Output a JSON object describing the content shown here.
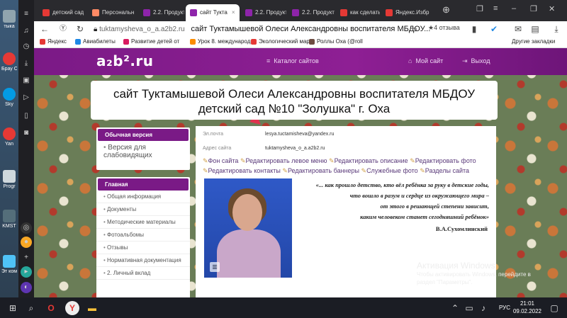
{
  "desktop": {
    "icons": [
      {
        "label": "тыка"
      },
      {
        "label": "Брау Ор"
      },
      {
        "label": "Sky"
      },
      {
        "label": "Yan"
      },
      {
        "label": "Progr"
      },
      {
        "label": "KMST"
      },
      {
        "label": "Эт компь"
      }
    ]
  },
  "browser": {
    "tabs": [
      {
        "label": "детский сад",
        "color": "#e53935"
      },
      {
        "label": "Персональн",
        "color": "#ff8a65"
      },
      {
        "label": "2.2. Продукт",
        "color": "#8e24aa"
      },
      {
        "label": "сайт Тукта",
        "color": "#8e24aa",
        "active": true
      },
      {
        "label": "2.2. Продукт",
        "color": "#8e24aa"
      },
      {
        "label": "2.2. Продукт",
        "color": "#8e24aa"
      },
      {
        "label": "как сделать",
        "color": "#e53935"
      },
      {
        "label": "Яндекс.Избр",
        "color": "#e53935"
      }
    ],
    "url_host": "tuktamysheva_o_a.a2b2.ru",
    "page_title": "сайт Тuktamyshevoй",
    "page_title_full": "сайт Туктамышевой Олеси Александровны воспитателя МБДОУ...",
    "reviews": "★4 отзыва",
    "bookmarks": [
      {
        "label": "Яндекс",
        "color": "#e53935"
      },
      {
        "label": "Авиабилеты",
        "color": "#1e88e5"
      },
      {
        "label": "Развитие детей от",
        "color": "#d81b60"
      },
      {
        "label": "Урок 8. международн",
        "color": "#fb8c00"
      },
      {
        "label": "Экологический мар",
        "color": "#e53935"
      },
      {
        "label": "Роллы Оха (@roll",
        "color": "#6d4c41"
      }
    ],
    "other_bookmarks": "Другие закладки"
  },
  "site": {
    "logo": "a₂b².ru",
    "nav": {
      "catalog": "Каталог сайтов",
      "my_site": "Мой сайт",
      "logout": "Выход"
    },
    "title_line1": "сайт Туктамышевой Олеси Александровны воспитателя МБДОУ",
    "title_line2": "детский сад №10 \"Золушка\" г. Оха",
    "sidebar": {
      "version_head": "Обычная версия",
      "version_item": "Версия для слабовидящих",
      "main_head": "Главная",
      "items": [
        "Общая информация",
        "Документы",
        "Методические материалы",
        "Фотоальбомы",
        "Отзывы",
        "Нормативная документация",
        "2. Личный вклад"
      ]
    },
    "info": {
      "email_label": "Эл.почта",
      "email": "lesya.tuctamisheva@yandex.ru",
      "site_label": "Адрес сайта",
      "site": "tuktamysheva_o_a.a2b2.ru"
    },
    "edit_links": [
      "Фон сайта",
      "Редактировать левое меню",
      "Редактировать описание",
      "Редактировать фото",
      "Редактировать контакты",
      "Редактировать баннеры",
      "Служебные фото",
      "Разделы сайта"
    ],
    "quote": {
      "l1": "«... как прошло детство, кто вёл ребёнка за руку в детские годы,",
      "l2": "что вошло в разум и сердце из окружающего мира –",
      "l3": "от этого в решающей степени зависит,",
      "l4": "каким человеком станет сегодняшний ребёнок»",
      "author": "В.А.Сухомлинский"
    },
    "activation": {
      "title": "Активация Windows",
      "line1": "Чтобы активировать Windows, перейдите в",
      "line2": "раздел \"Параметры\"."
    }
  },
  "taskbar": {
    "lang": "РУС",
    "time": "21:01",
    "date": "09.02.2022"
  }
}
